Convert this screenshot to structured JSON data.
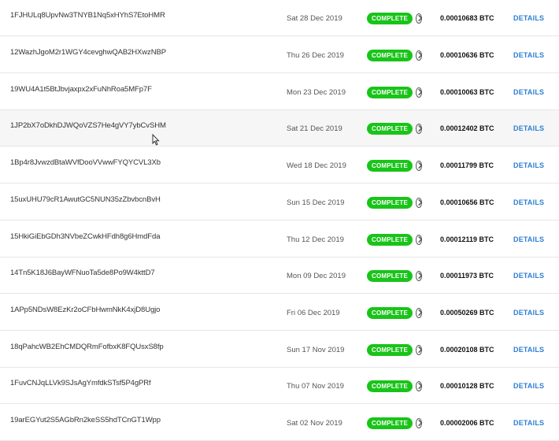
{
  "transactions": [
    {
      "address": "1FJHULq8UpvNw3TNYB1Nq5xHYhS7EtoHMR",
      "date": "Sat 28 Dec 2019",
      "status": "COMPLETE",
      "amount": "0.00010683 BTC",
      "details": "DETAILS"
    },
    {
      "address": "12WazhJgoM2r1WGY4cevghwQAB2HXwzNBP",
      "date": "Thu 26 Dec 2019",
      "status": "COMPLETE",
      "amount": "0.00010636 BTC",
      "details": "DETAILS"
    },
    {
      "address": "19WU4A1t5BtJbvjaxpx2xFuNhRoa5MFp7F",
      "date": "Mon 23 Dec 2019",
      "status": "COMPLETE",
      "amount": "0.00010063 BTC",
      "details": "DETAILS"
    },
    {
      "address": "1JP2bX7oDkhDJWQoVZS7He4gVY7ybCvSHM",
      "date": "Sat 21 Dec 2019",
      "status": "COMPLETE",
      "amount": "0.00012402 BTC",
      "details": "DETAILS"
    },
    {
      "address": "1Bp4r8JvwzdBtaWVfDooVVwwFYQYCVL3Xb",
      "date": "Wed 18 Dec 2019",
      "status": "COMPLETE",
      "amount": "0.00011799 BTC",
      "details": "DETAILS"
    },
    {
      "address": "15uxUHU79cR1AwutGC5NUN35zZbvbcnBvH",
      "date": "Sun 15 Dec 2019",
      "status": "COMPLETE",
      "amount": "0.00010656 BTC",
      "details": "DETAILS"
    },
    {
      "address": "15HkiGiEbGDh3NVbeZCwkHFdh8g6HmdFda",
      "date": "Thu 12 Dec 2019",
      "status": "COMPLETE",
      "amount": "0.00012119 BTC",
      "details": "DETAILS"
    },
    {
      "address": "14Tn5K18J6BayWFNuoTa5de8Po9W4kttD7",
      "date": "Mon 09 Dec 2019",
      "status": "COMPLETE",
      "amount": "0.00011973 BTC",
      "details": "DETAILS"
    },
    {
      "address": "1APp5NDsW8EzKr2oCFbHwmNkK4xjD8Ugjo",
      "date": "Fri 06 Dec 2019",
      "status": "COMPLETE",
      "amount": "0.00050269 BTC",
      "details": "DETAILS"
    },
    {
      "address": "18qPahcWB2EhCMDQRmFofbxK8FQUsxS8fp",
      "date": "Sun 17 Nov 2019",
      "status": "COMPLETE",
      "amount": "0.00020108 BTC",
      "details": "DETAILS"
    },
    {
      "address": "1FuvCNJqLLVk9SJsAgYmfdkSTsf5P4gPRf",
      "date": "Thu 07 Nov 2019",
      "status": "COMPLETE",
      "amount": "0.00010128 BTC",
      "details": "DETAILS"
    },
    {
      "address": "19arEGYut2S5AGbRn2keSS5hdTCnGT1Wpp",
      "date": "Sat 02 Nov 2019",
      "status": "COMPLETE",
      "amount": "0.00002006 BTC",
      "details": "DETAILS"
    }
  ],
  "colors": {
    "complete": "#19c419",
    "details_link": "#2d7fd3"
  },
  "icons": {
    "row_action": "chevron-right-circle-icon",
    "pointer": "mouse-cursor-icon"
  }
}
